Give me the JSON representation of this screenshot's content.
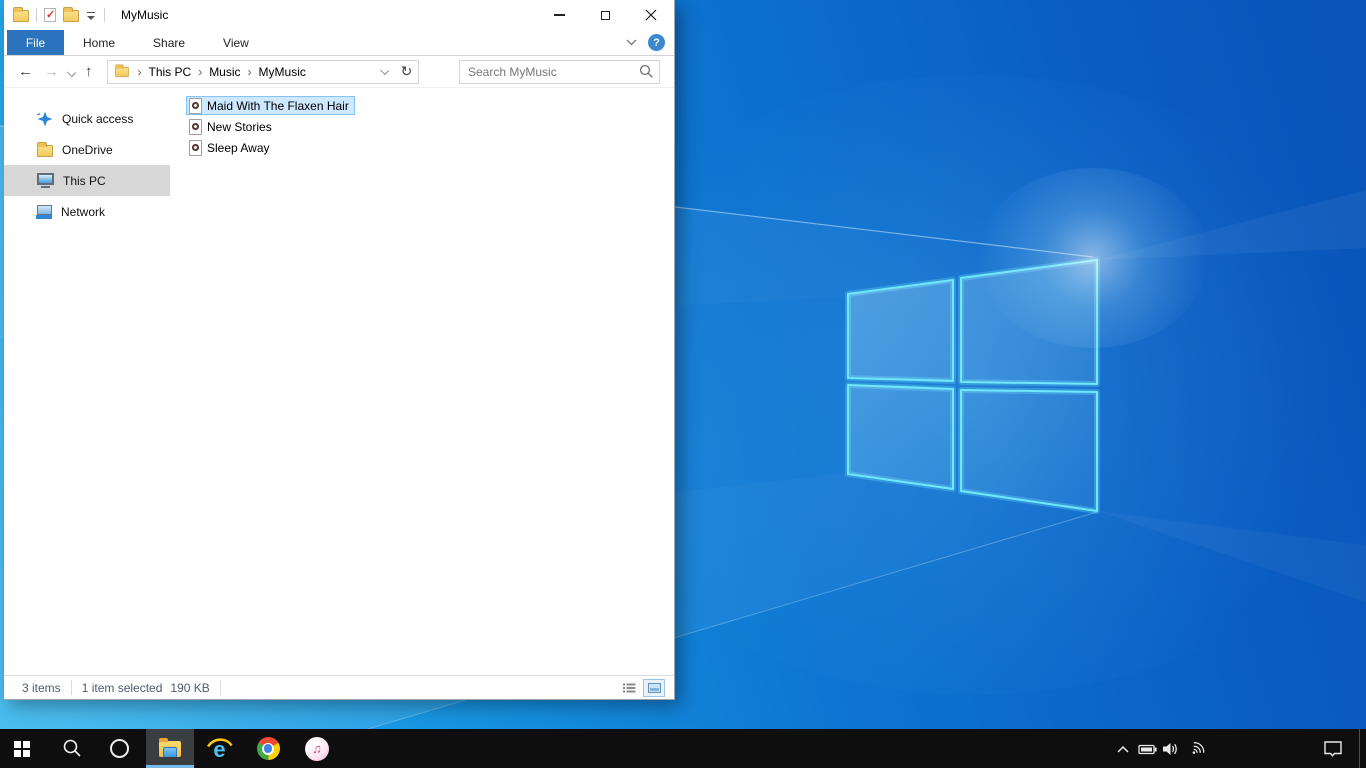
{
  "window": {
    "title": "MyMusic",
    "qat_icons": [
      "explorer-window-folder",
      "properties",
      "new-folder",
      "customize-dropdown"
    ],
    "controls": [
      "minimize",
      "maximize",
      "close"
    ]
  },
  "ribbon": {
    "tabs": [
      "File",
      "Home",
      "Share",
      "View"
    ],
    "active_tab": "File",
    "help_label": "?",
    "icons": [
      "ribbon-collapse-chevron",
      "help"
    ]
  },
  "navbar": {
    "breadcrumb": {
      "root_icon": "folder-icon",
      "items": [
        "This PC",
        "Music",
        "MyMusic"
      ]
    },
    "search_placeholder": "Search MyMusic",
    "glyphs": {
      "back": "←",
      "forward": "→",
      "up": "↑",
      "refresh": "↻",
      "crumb_sep": "›"
    },
    "icons": [
      "back-arrow",
      "forward-arrow",
      "recent-locations-chevron",
      "up-arrow",
      "address-dropdown-chevron",
      "refresh",
      "search-magnifier"
    ]
  },
  "sidebar": {
    "items": [
      {
        "label": "Quick access",
        "icon": "quick-access-star",
        "selected": false
      },
      {
        "label": "OneDrive",
        "icon": "folder",
        "selected": false
      },
      {
        "label": "This PC",
        "icon": "this-pc-monitor",
        "selected": true
      },
      {
        "label": "Network",
        "icon": "network-computer",
        "selected": false
      }
    ]
  },
  "files": {
    "items": [
      {
        "name": "Maid With The Flaxen Hair",
        "icon": "audio-file",
        "selected": true
      },
      {
        "name": "New Stories",
        "icon": "audio-file",
        "selected": false
      },
      {
        "name": "Sleep Away",
        "icon": "audio-file",
        "selected": false
      }
    ]
  },
  "statusbar": {
    "count": "3 items",
    "selected": "1 item selected",
    "size": "190 KB",
    "view_icons": [
      "details-view",
      "large-thumbnails-view"
    ]
  },
  "taskbar": {
    "buttons": [
      "start",
      "search",
      "cortana",
      "file-explorer",
      "internet-explorer",
      "chrome",
      "itunes"
    ],
    "active_button": "file-explorer",
    "tray_icons": [
      "tray-expand-chevron",
      "battery",
      "volume",
      "wifi",
      "action-center"
    ],
    "ie_glyph": "e",
    "itunes_glyph": "♫"
  },
  "colors": {
    "accent_blue": "#2b74bd",
    "selection_bg": "#cde8ff",
    "selection_border": "#84c3f4",
    "sidebar_selected": "#d7d7d7",
    "taskbar_bg": "#0e0e0e",
    "taskbar_underline": "#76b9ed",
    "desktop_base": "#0a62c4",
    "logo_stroke": "#6fe8fa"
  }
}
